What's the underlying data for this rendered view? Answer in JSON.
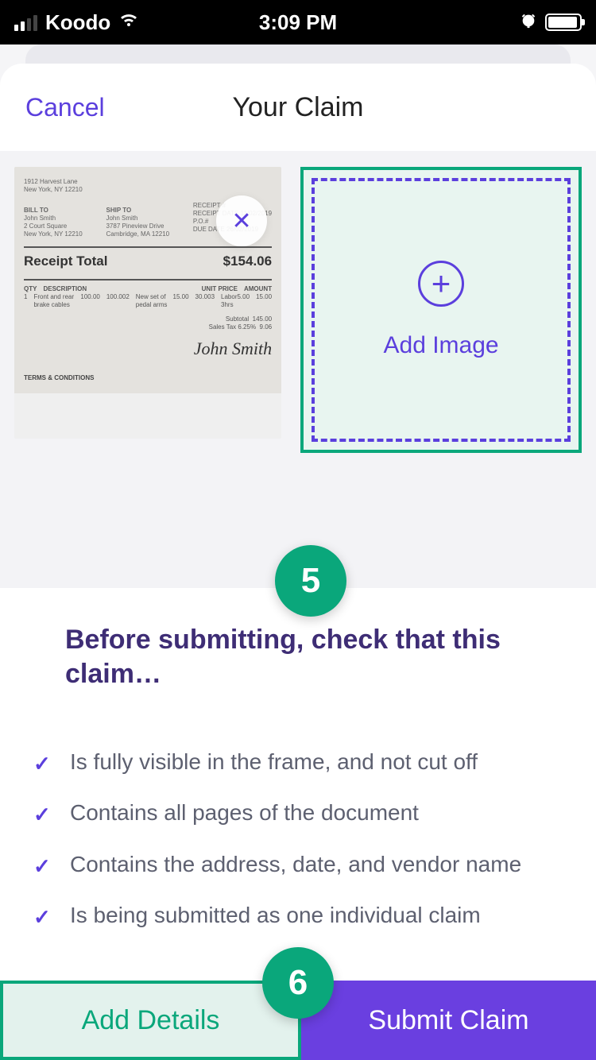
{
  "status": {
    "carrier": "Koodo",
    "time": "3:09 PM"
  },
  "header": {
    "cancel": "Cancel",
    "title": "Your Claim"
  },
  "gallery": {
    "add_image_label": "Add Image",
    "step_badge_5": "5",
    "receipt": {
      "address_line1": "1912 Harvest Lane",
      "address_line2": "New York, NY 12210",
      "bill_to_label": "BILL TO",
      "bill_to_name": "John Smith",
      "bill_to_addr1": "2 Court Square",
      "bill_to_addr2": "New York, NY 12210",
      "ship_to_label": "SHIP TO",
      "ship_to_name": "John Smith",
      "ship_to_addr1": "3787 Pineview Drive",
      "ship_to_addr2": "Cambridge, MA 12210",
      "receipt_num_label": "RECEIPT #",
      "receipt_date_label": "RECEIPT DATE",
      "receipt_date": "11/02/2019",
      "po_label": "P.O.#",
      "due_date_label": "DUE DATE",
      "due_date": "26/02/2019",
      "total_label": "Receipt Total",
      "total_value": "$154.06",
      "col_qty": "QTY",
      "col_desc": "DESCRIPTION",
      "col_unit": "UNIT PRICE",
      "col_amount": "AMOUNT",
      "items": [
        {
          "qty": "1",
          "desc": "Front and rear brake cables",
          "unit": "100.00",
          "amount": "100.00"
        },
        {
          "qty": "2",
          "desc": "New set of pedal arms",
          "unit": "15.00",
          "amount": "30.00"
        },
        {
          "qty": "3",
          "desc": "Labor 3hrs",
          "unit": "5.00",
          "amount": "15.00"
        }
      ],
      "subtotal_label": "Subtotal",
      "subtotal": "145.00",
      "tax_label": "Sales Tax 6.25%",
      "tax": "9.06",
      "signature": "John Smith",
      "terms": "TERMS & CONDITIONS"
    }
  },
  "checklist": {
    "heading": "Before submitting, check that this claim…",
    "items": [
      "Is fully visible in the frame, and not cut off",
      "Contains all pages of the document",
      "Contains the address, date, and vendor name",
      "Is being submitted as one individual claim"
    ]
  },
  "actions": {
    "add_details": "Add Details",
    "submit": "Submit Claim",
    "step_badge_6": "6"
  }
}
